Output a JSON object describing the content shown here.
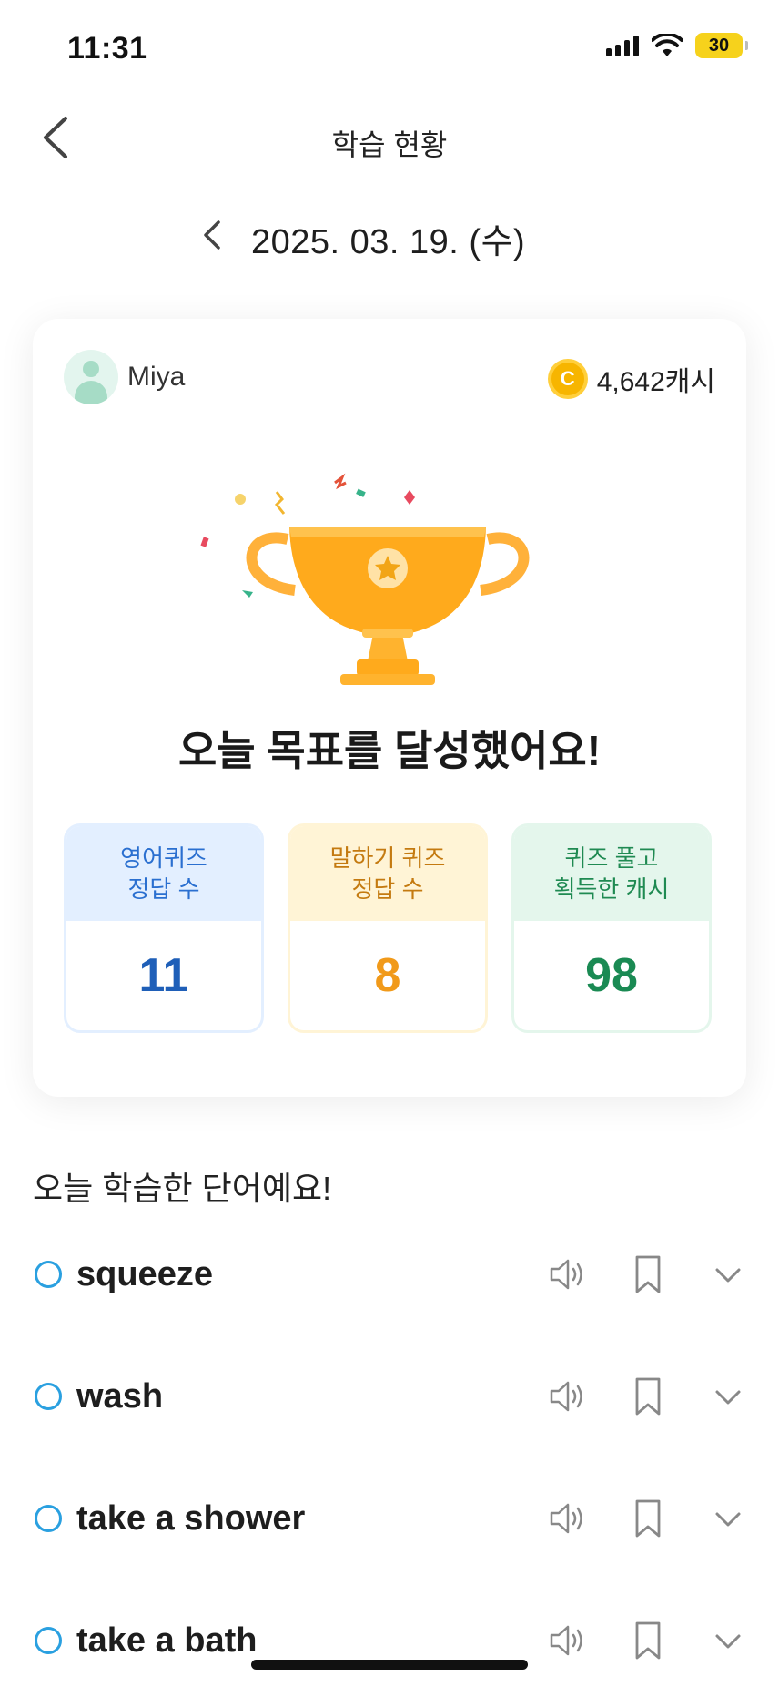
{
  "status_bar": {
    "time": "11:31",
    "battery": "30"
  },
  "header": {
    "title": "학습 현황"
  },
  "date": {
    "text": "2025. 03. 19. (수)"
  },
  "summary_card": {
    "user_name": "Miya",
    "cash": "4,642캐시",
    "coin_symbol": "C",
    "headline": "오늘 목표를 달성했어요!",
    "stats": [
      {
        "label": "영어퀴즈\n정답 수",
        "value": "11",
        "color": "#1f5fb8"
      },
      {
        "label": "말하기 퀴즈\n정답 수",
        "value": "8",
        "color": "#f19a1a"
      },
      {
        "label": "퀴즈 풀고\n획득한 캐시",
        "value": "98",
        "color": "#1a8a53"
      }
    ]
  },
  "words_section": {
    "title": "오늘 학습한 단어예요!",
    "words": [
      {
        "word": "squeeze"
      },
      {
        "word": "wash"
      },
      {
        "word": "take a shower"
      },
      {
        "word": "take a bath"
      }
    ]
  },
  "colors": {
    "accent": "#2aa0e0",
    "trophy": "#ffaa1c"
  }
}
